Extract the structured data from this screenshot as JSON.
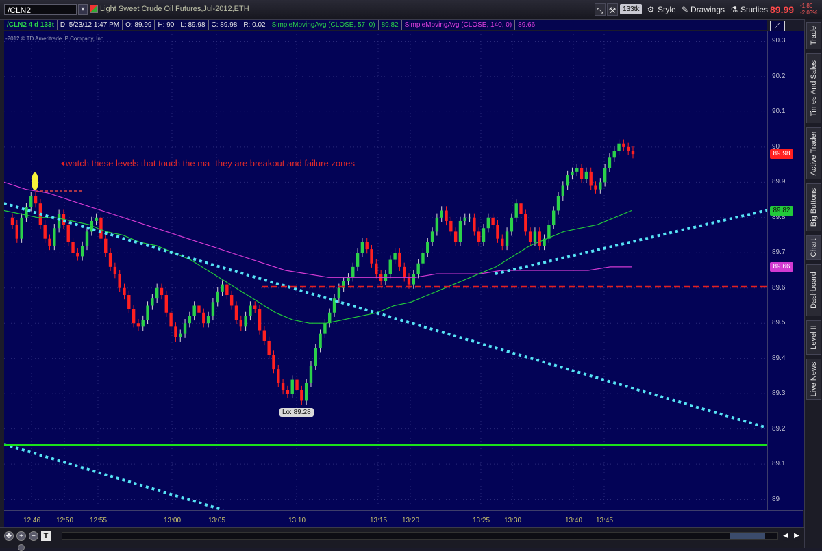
{
  "toolbar": {
    "symbol": "/CLN2",
    "description": "Light Sweet Crude Oil Futures,Jul-2012,ETH",
    "tick_count": "133tk",
    "style_label": "Style",
    "drawings_label": "Drawings",
    "studies_label": "Studies",
    "last_price": "89.99",
    "change": "-1.86",
    "change_pct": "-2.03%"
  },
  "info": {
    "period": "/CLN2 4 d 133t",
    "date": "D: 5/23/12 1:47 PM",
    "open": "O: 89.99",
    "high": "H: 90",
    "low": "L: 89.98",
    "close": "C: 89.98",
    "range": "R: 0.02",
    "sma1_label": "SimpleMovingAvg (CLOSE, 57, 0)",
    "sma1_value": "89.82",
    "sma2_label": "SimpleMovingAvg (CLOSE, 140, 0)",
    "sma2_value": "89.66"
  },
  "copyright": "-2012 © TD Ameritrade IP Company, Inc.",
  "annotation": "watch these levels that touch the ma -they are breakout and failure  zones",
  "low_label": "Lo: 89.28",
  "sidebar_tabs": [
    "Trade",
    "Times And Sales",
    "Active Trader",
    "Big Buttons",
    "Chart",
    "Dashboard",
    "Level II",
    "Live News"
  ],
  "active_tab": "Chart",
  "colors": {
    "background": "#030356",
    "up_candle": "#2bd14a",
    "down_candle": "#ff2020",
    "sma57": "#22c93a",
    "sma140": "#d23ad2",
    "trendline": "#56e3f5",
    "support": "#1be21b",
    "resistance": "#e52020"
  },
  "chart_data": {
    "type": "candlestick",
    "ylim": [
      88.97,
      90.33
    ],
    "yticks": [
      90.3,
      90.2,
      90.1,
      90,
      89.9,
      89.8,
      89.7,
      89.6,
      89.5,
      89.4,
      89.3,
      89.2,
      89.1,
      89
    ],
    "xticks": [
      "12:46",
      "12:50",
      "12:55",
      "13:00",
      "13:05",
      "13:10",
      "13:15",
      "13:20",
      "13:25",
      "13:30",
      "13:40",
      "13:45"
    ],
    "price_labels": [
      {
        "text": "89.98",
        "value": 89.98,
        "color": "#ff2020"
      },
      {
        "text": "89.82",
        "value": 89.82,
        "color": "#22c93a"
      },
      {
        "text": "89.66",
        "value": 89.66,
        "color": "#d23ad2"
      }
    ],
    "closes": [
      89.78,
      89.74,
      89.8,
      89.83,
      89.86,
      89.84,
      89.78,
      89.74,
      89.72,
      89.77,
      89.81,
      89.78,
      89.73,
      89.7,
      89.69,
      89.72,
      89.76,
      89.79,
      89.8,
      89.74,
      89.7,
      89.66,
      89.64,
      89.6,
      89.58,
      89.54,
      89.5,
      89.49,
      89.51,
      89.55,
      89.57,
      89.6,
      89.58,
      89.53,
      89.49,
      89.46,
      89.47,
      89.5,
      89.52,
      89.55,
      89.53,
      89.5,
      89.52,
      89.56,
      89.59,
      89.61,
      89.58,
      89.55,
      89.51,
      89.49,
      89.52,
      89.55,
      89.54,
      89.48,
      89.45,
      89.41,
      89.37,
      89.33,
      89.31,
      89.3,
      89.34,
      89.31,
      89.28,
      89.33,
      89.38,
      89.43,
      89.47,
      89.5,
      89.53,
      89.57,
      89.6,
      89.62,
      89.63,
      89.66,
      89.7,
      89.73,
      89.71,
      89.67,
      89.64,
      89.62,
      89.64,
      89.68,
      89.7,
      89.66,
      89.63,
      89.61,
      89.64,
      89.67,
      89.7,
      89.73,
      89.76,
      89.8,
      89.82,
      89.79,
      89.76,
      89.73,
      89.79,
      89.8,
      89.8,
      89.76,
      89.73,
      89.77,
      89.8,
      89.78,
      89.74,
      89.72,
      89.76,
      89.8,
      89.84,
      89.81,
      89.76,
      89.73,
      89.76,
      89.72,
      89.74,
      89.78,
      89.82,
      89.86,
      89.89,
      89.92,
      89.93,
      89.94,
      89.91,
      89.93,
      89.89,
      89.88,
      89.9,
      89.94,
      89.97,
      89.99,
      90.01,
      90,
      89.99,
      89.98
    ],
    "sma57": [
      89.82,
      89.81,
      89.8,
      89.8,
      89.79,
      89.78,
      89.76,
      89.75,
      89.73,
      89.72,
      89.7,
      89.68,
      89.65,
      89.62,
      89.59,
      89.56,
      89.53,
      89.51,
      89.5,
      89.5,
      89.51,
      89.52,
      89.53,
      89.55,
      89.56,
      89.58,
      89.6,
      89.62,
      89.64,
      89.66,
      89.69,
      89.72,
      89.74,
      89.76,
      89.77,
      89.78,
      89.8,
      89.82
    ],
    "sma140": [
      89.9,
      89.88,
      89.87,
      89.85,
      89.83,
      89.81,
      89.79,
      89.77,
      89.75,
      89.73,
      89.71,
      89.69,
      89.67,
      89.65,
      89.64,
      89.63,
      89.63,
      89.63,
      89.63,
      89.63,
      89.64,
      89.64,
      89.64,
      89.65,
      89.65,
      89.65,
      89.65,
      89.65,
      89.66,
      89.66
    ]
  }
}
